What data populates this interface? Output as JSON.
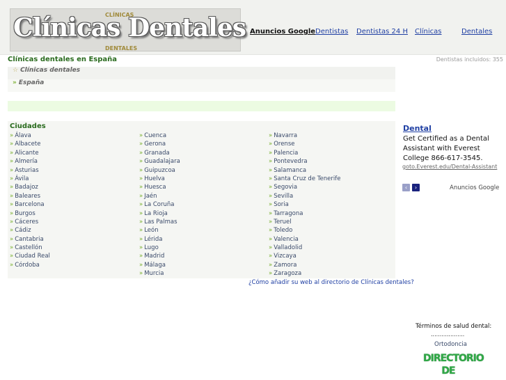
{
  "header": {
    "logo_text": "Clínicas Dentales",
    "logo_sub_top": "CLÍNICAS",
    "logo_sub_bottom": "DENTALES",
    "nav": [
      "Anuncios Google",
      "Dentistas",
      "Dentistas 24 H",
      "Clínicas",
      "Dentales"
    ]
  },
  "page_title": "Clínicas dentales en España",
  "count_text": "Dentistas incluidos: 355",
  "breadcrumb": {
    "level1": "Clínicas dentales",
    "level2": "España"
  },
  "cities": {
    "title": "Ciudades",
    "columns": [
      [
        "Álava",
        "Albacete",
        "Alicante",
        "Almería",
        "Asturias",
        "Ávila",
        "Badajoz",
        "Baleares",
        "Barcelona",
        "Burgos",
        "Cáceres",
        "Cádiz",
        "Cantabria",
        "Castellón",
        "Ciudad Real",
        "Córdoba"
      ],
      [
        "Cuenca",
        "Gerona",
        "Granada",
        "Guadalajara",
        "Guipuzcoa",
        "Huelva",
        "Huesca",
        "Jaén",
        "La Coruña",
        "La Rioja",
        "Las Palmas",
        "León",
        "Lérida",
        "Lugo",
        "Madrid",
        "Málaga",
        "Murcia"
      ],
      [
        "Navarra",
        "Orense",
        "Palencia",
        "Pontevedra",
        "Salamanca",
        "Santa Cruz de Tenerife",
        "Segovia",
        "Sevilla",
        "Soria",
        "Tarragona",
        "Teruel",
        "Toledo",
        "Valencia",
        "Valladolid",
        "Vizcaya",
        "Zamora",
        "Zaragoza"
      ]
    ],
    "add_link": "¿Cómo añadir su web al directorio de Clínicas dentales?"
  },
  "ad": {
    "title": "Dental",
    "body": "Get Certified as a Dental Assistant with Everest College 866-617-3545.",
    "url": "goto.Everest.edu/Dental-Assistant",
    "prev": "‹",
    "next": "›",
    "footer": "Anuncios Google"
  },
  "terms": {
    "title": "Términos de salud dental:",
    "dots": "...................",
    "link": "Ortodoncia",
    "logo_line1": "DIRECTORIO",
    "logo_line2": "DE"
  },
  "colors": {
    "link": "#1f3fa3",
    "green_heading": "#2a6b1e",
    "arrow": "#7ab030"
  }
}
